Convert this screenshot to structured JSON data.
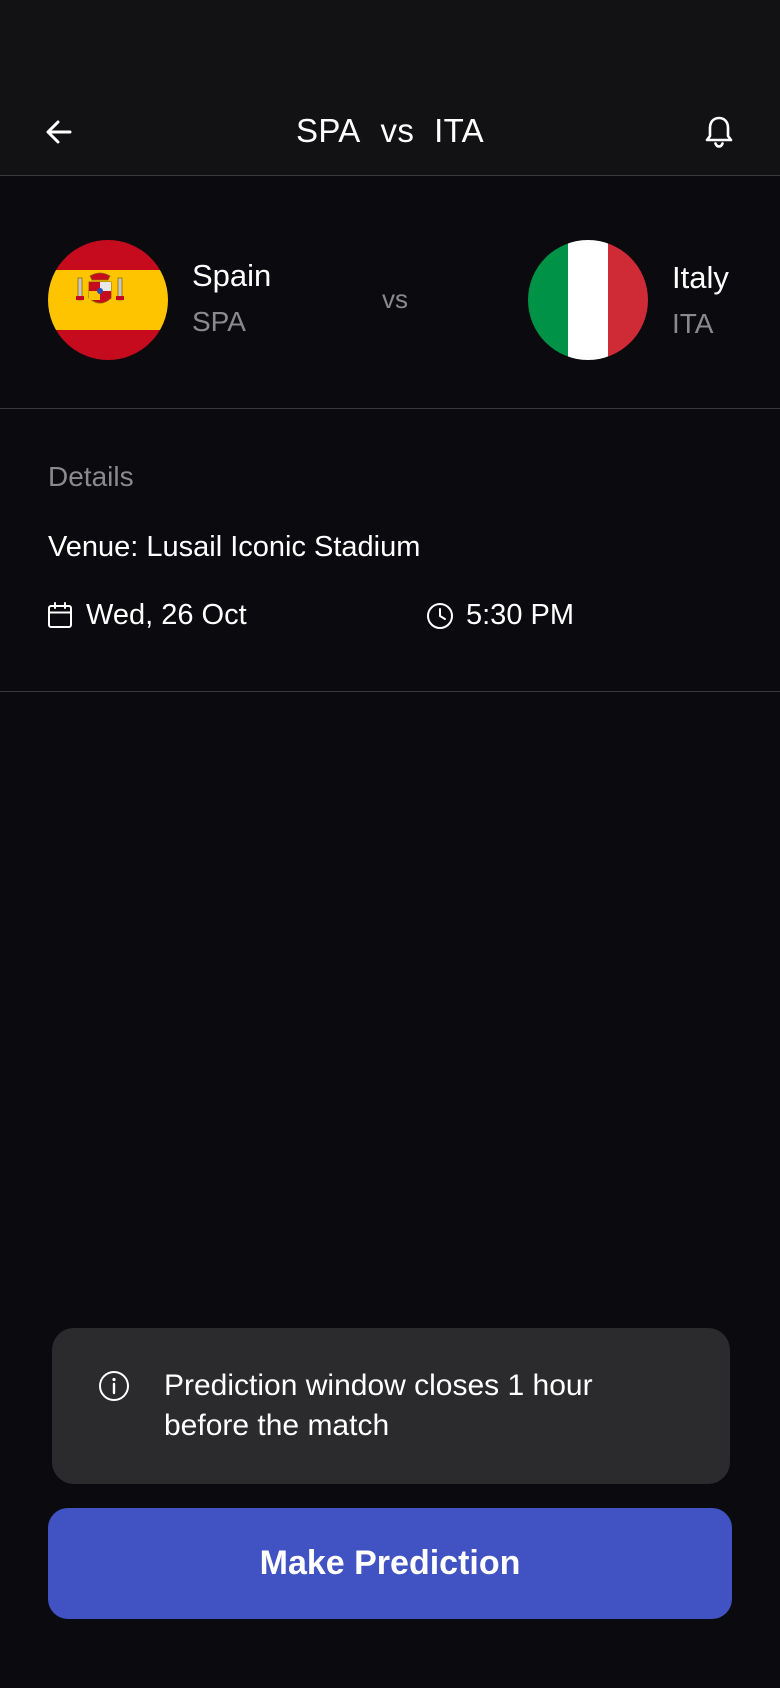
{
  "header": {
    "home_code": "SPA",
    "vs": "vs",
    "away_code": "ITA",
    "back_icon": "arrow-left-icon",
    "notification_icon": "bell-icon"
  },
  "match": {
    "home": {
      "name": "Spain",
      "code": "SPA",
      "flag_colors": [
        "#c60b1e",
        "#ffc400",
        "#c60b1e"
      ]
    },
    "vs": "vs",
    "away": {
      "name": "Italy",
      "code": "ITA",
      "flag_colors": [
        "#009246",
        "#ffffff",
        "#ce2b37"
      ]
    }
  },
  "details": {
    "label": "Details",
    "venue": "Venue: Lusail Iconic Stadium",
    "date": "Wed, 26 Oct",
    "time": "5:30 PM",
    "date_icon": "calendar-icon",
    "time_icon": "clock-icon"
  },
  "notice": {
    "icon": "info-icon",
    "text": "Prediction window closes 1 hour before the match"
  },
  "cta": {
    "label": "Make Prediction",
    "color": "#4152c2"
  },
  "colors": {
    "background": "#0b0b0f",
    "header_background": "#121214",
    "muted_text": "#8a8a8e",
    "card_background": "#2b2b2d"
  }
}
